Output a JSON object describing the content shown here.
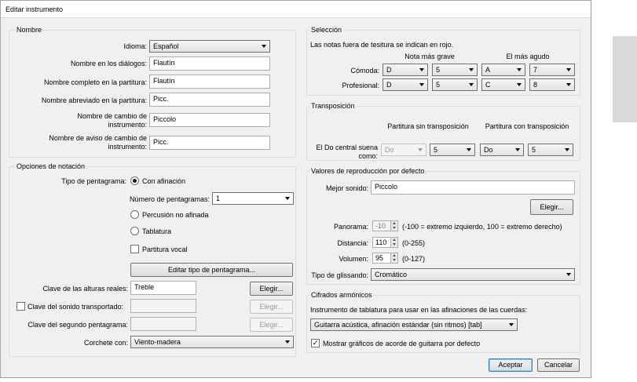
{
  "window": {
    "title": "Editar instrumento"
  },
  "nombre": {
    "title": "Nombre",
    "idioma_label": "Idioma:",
    "idioma_value": "Español",
    "dialog_name_label": "Nombre en los diálogos:",
    "dialog_name_value": "Flautín",
    "full_name_label": "Nombre completo en la partitura:",
    "full_name_value": "Flautín",
    "short_name_label": "Nombre abreviado en la partitura:",
    "short_name_value": "Picc.",
    "change_name_label_1": "Nombre de cambio de",
    "change_name_label_2": "instrumento:",
    "change_name_value": "Piccolo",
    "warn_name_label_1": "Nombre de aviso de cambio de",
    "warn_name_label_2": "instrumento:",
    "warn_name_value": "Picc."
  },
  "notacion": {
    "title": "Opciones de notación",
    "staff_type_label": "Tipo de pentagrama:",
    "radio_tuned": "Con afinación",
    "staff_count_label": "Número de pentagramas:",
    "staff_count_value": "1",
    "radio_percussion": "Percusión no afinada",
    "radio_tab": "Tablatura",
    "check_vocal": "Partitura vocal",
    "edit_staff_type_button": "Editar tipo de pentagrama...",
    "real_clef_label": "Clave de las alturas reales:",
    "real_clef_value": "Treble",
    "transposed_clef_label": "Clave del sonido transportado:",
    "transposed_clef_value": "",
    "second_staff_clef_label": "Clave del segundo pentagrama:",
    "second_staff_clef_value": "",
    "choose_button": "Elegir...",
    "bracket_label": "Corchete con:",
    "bracket_value": "Viento-madera"
  },
  "seleccion": {
    "title": "Selección",
    "note": "Las notas fuera de tesitura se indican en rojo.",
    "lowest_header": "Nota más grave",
    "highest_header": "El más agudo",
    "comfortable_label": "Cómoda:",
    "comfortable": {
      "low_note": "D",
      "low_octave": "5",
      "high_note": "A",
      "high_octave": "7"
    },
    "professional_label": "Profesional:",
    "professional": {
      "low_note": "D",
      "low_octave": "5",
      "high_note": "C",
      "high_octave": "8"
    }
  },
  "transposicion": {
    "title": "Transposición",
    "non_transposing_header": "Partitura sin transposición",
    "transposing_header": "Partitura con transposición",
    "middle_c_label_1": "El Do central suena",
    "middle_c_label_2": "como:",
    "nt_note": "Do",
    "nt_octave": "5",
    "t_note": "Do",
    "t_octave": "5"
  },
  "reproduccion": {
    "title": "Valores de reproducción por defecto",
    "best_sound_label": "Mejor sonido:",
    "best_sound_value": "Piccolo",
    "choose_button": "Elegir...",
    "pan_label": "Panorama:",
    "pan_value": "-10",
    "pan_hint": "(-100 = extremo izquierdo, 100 = extremo derecho)",
    "distance_label": "Distancia:",
    "distance_value": "110",
    "distance_hint": "(0-255)",
    "volume_label": "Volumen:",
    "volume_value": "95",
    "volume_hint": "(0-127)",
    "gliss_label": "Tipo de glissando:",
    "gliss_value": "Cromático"
  },
  "cifrados": {
    "title": "Cifrados armónicos",
    "tab_instrument_label": "Instrumento de tablatura para usar en las afinaciones de las cuerdas:",
    "tab_instrument_value": "Guitarra acústica, afinación estándar (sin ritmos) [tab]",
    "show_chords_check": "Mostrar gráficos de acorde de guitarra por defecto"
  },
  "footer": {
    "accept_button": "Aceptar",
    "cancel_button": "Cancelar"
  }
}
